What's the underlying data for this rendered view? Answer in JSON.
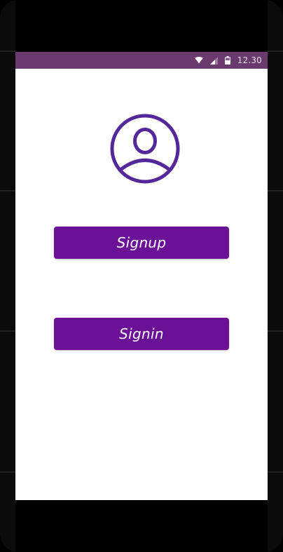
{
  "status_bar": {
    "time": "12.30",
    "icons": [
      "wifi-icon",
      "cellular-signal-icon",
      "battery-icon"
    ],
    "background": "#6a3a6e"
  },
  "avatar": {
    "icon": "user-profile-icon",
    "color": "#54289a"
  },
  "buttons": {
    "signup_label": "Signup",
    "signin_label": "Signin",
    "color": "#6a1197"
  }
}
